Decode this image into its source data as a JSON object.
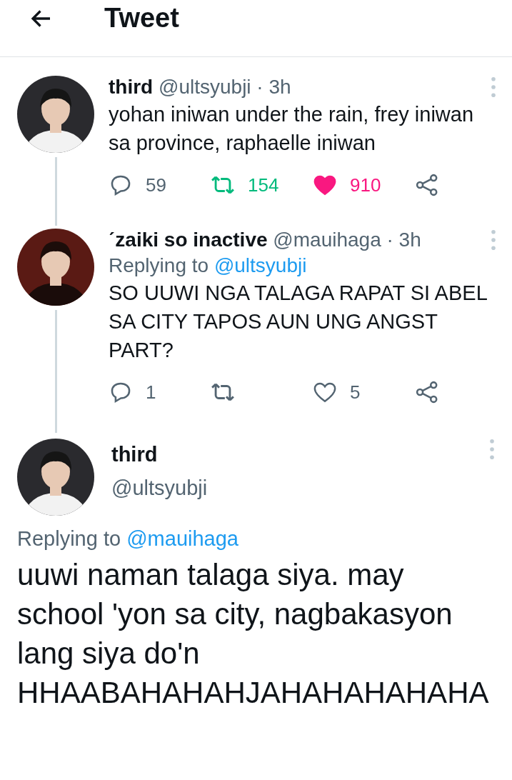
{
  "header": {
    "title": "Tweet"
  },
  "replies": [
    {
      "name": "third",
      "handle": "@ultsyubji",
      "time": "· 3h",
      "text": "yohan iniwan under the rain, frey iniwan sa province, raphaelle iniwan",
      "actions": {
        "reply": "59",
        "retweet": "154",
        "retweeted": true,
        "like": "910",
        "liked": true
      }
    },
    {
      "name": "ˊzaiki so inactive",
      "handle": "@mauihaga",
      "time": "· 3h",
      "replying_prefix": "Replying to",
      "replying_to": "@ultsyubji",
      "text": "SO UUWI NGA TALAGA RAPAT SI ABEL SA CITY TAPOS AUN UNG ANGST PART?",
      "actions": {
        "reply": "1",
        "retweeted": false,
        "like": "5",
        "liked": false
      }
    }
  ],
  "main": {
    "name": "third",
    "handle": "@ultsyubji",
    "replying_prefix": "Replying to",
    "replying_to": "@mauihaga",
    "text": "uuwi naman talaga siya. may school 'yon sa city, nagbakasyon lang siya do'n HHAABAHAHAHJAHAHAHAHAHA"
  }
}
